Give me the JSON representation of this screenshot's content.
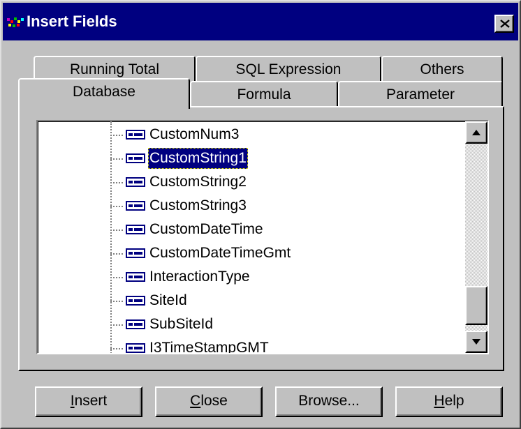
{
  "window": {
    "title": "Insert Fields",
    "close_label": "close"
  },
  "tabs": {
    "back_row": [
      "Running Total",
      "SQL Expression",
      "Others"
    ],
    "front_row": [
      "Database",
      "Formula",
      "Parameter"
    ],
    "selected": "Database"
  },
  "tree": {
    "items": [
      "CustomNum3",
      "CustomString1",
      "CustomString2",
      "CustomString3",
      "CustomDateTime",
      "CustomDateTimeGmt",
      "InteractionType",
      "SiteId",
      "SubSiteId",
      "I3TimeStampGMT"
    ],
    "selected_item": "CustomString1"
  },
  "scrollbar": {
    "thumb_position_fraction": 0.82
  },
  "buttons": {
    "insert": {
      "accel": "I",
      "rest": "nsert"
    },
    "close": {
      "accel": "C",
      "rest": "lose"
    },
    "browse": "Browse...",
    "help": {
      "accel": "H",
      "rest": "elp"
    }
  },
  "colors": {
    "titlebar": "#000080",
    "face": "#c0c0c0",
    "selection": "#000080",
    "field_icon": "#000080"
  },
  "icons": {
    "app": "crystal-reports-icon",
    "field": "database-field-icon",
    "close": "close-x-icon",
    "scroll_up": "arrow-up-icon",
    "scroll_down": "arrow-down-icon"
  }
}
